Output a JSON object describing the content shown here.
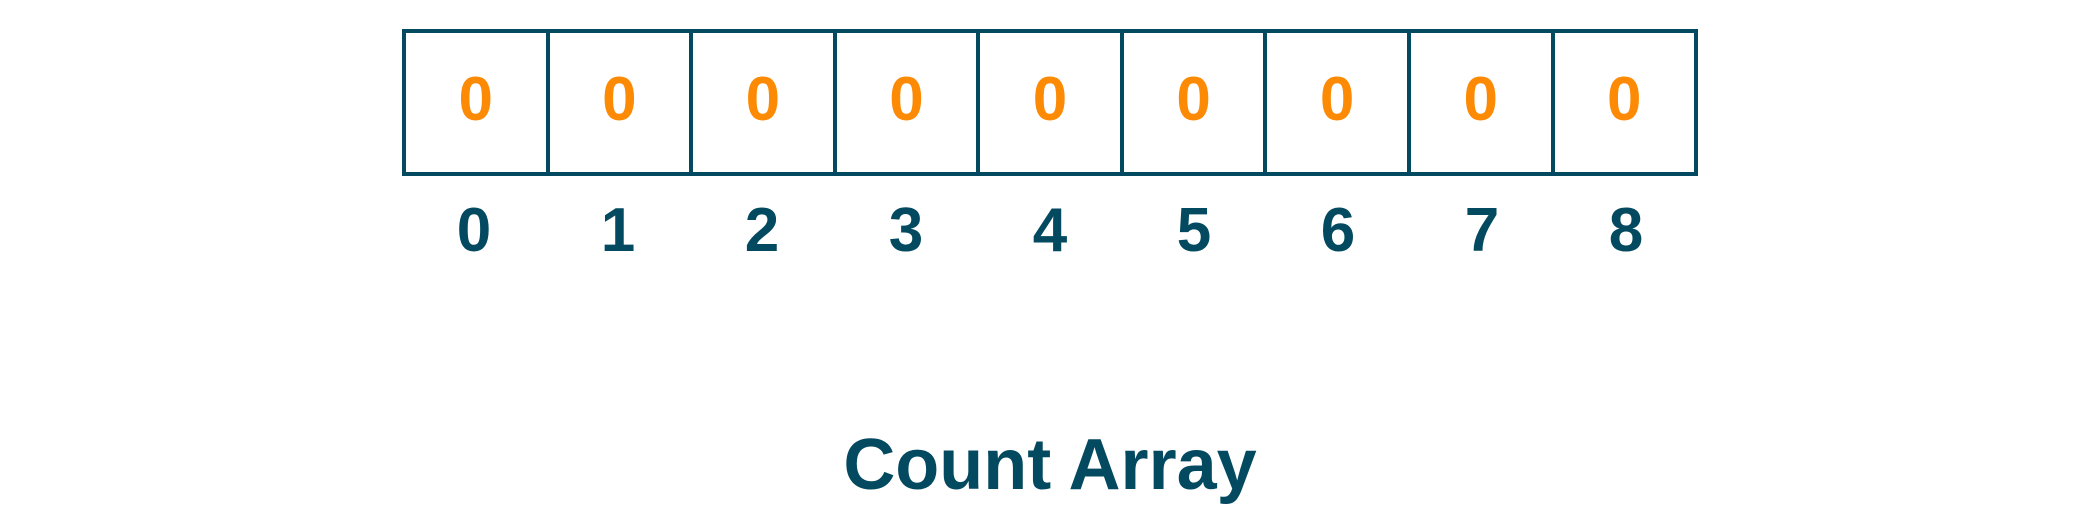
{
  "diagram": {
    "title": "Count Array",
    "values": [
      "0",
      "0",
      "0",
      "0",
      "0",
      "0",
      "0",
      "0",
      "0"
    ],
    "indices": [
      "0",
      "1",
      "2",
      "3",
      "4",
      "5",
      "6",
      "7",
      "8"
    ],
    "colors": {
      "border": "#034a60",
      "value": "#fc8a04",
      "index": "#034a60"
    }
  }
}
